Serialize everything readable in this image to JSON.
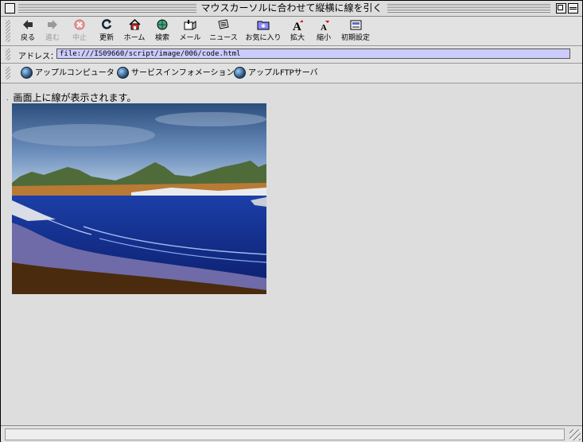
{
  "window": {
    "title": "マウスカーソルに合わせて縦横に線を引く"
  },
  "toolbar": {
    "buttons": [
      {
        "label": "戻る",
        "icon": "back-arrow-icon"
      },
      {
        "label": "進む",
        "icon": "forward-arrow-icon",
        "disabled": true
      },
      {
        "label": "中止",
        "icon": "stop-icon",
        "disabled": true
      },
      {
        "label": "更新",
        "icon": "refresh-icon"
      },
      {
        "label": "ホーム",
        "icon": "home-icon"
      },
      {
        "label": "検索",
        "icon": "search-globe-icon"
      },
      {
        "label": "メール",
        "icon": "mail-icon"
      },
      {
        "label": "ニュース",
        "icon": "news-icon"
      },
      {
        "label": "お気に入り",
        "icon": "favorites-folder-icon"
      },
      {
        "label": "拡大",
        "icon": "font-larger-icon"
      },
      {
        "label": "縮小",
        "icon": "font-smaller-icon"
      },
      {
        "label": "初期設定",
        "icon": "preferences-icon"
      }
    ]
  },
  "address": {
    "label": "アドレス：",
    "url": "file:///IS09660/script/image/006/code.html"
  },
  "favorites": [
    {
      "label": "アップルコンピュータ",
      "icon": "globe-icon"
    },
    {
      "label": "サービスインフォメーション",
      "icon": "globe-icon"
    },
    {
      "label": "アップルFTPサーバ",
      "icon": "globe-icon"
    }
  ],
  "content": {
    "text": "画面上に線が表示されます。",
    "bullet": "."
  },
  "colors": {
    "address_field": "#ccccff",
    "window_bg": "#dddddd"
  }
}
